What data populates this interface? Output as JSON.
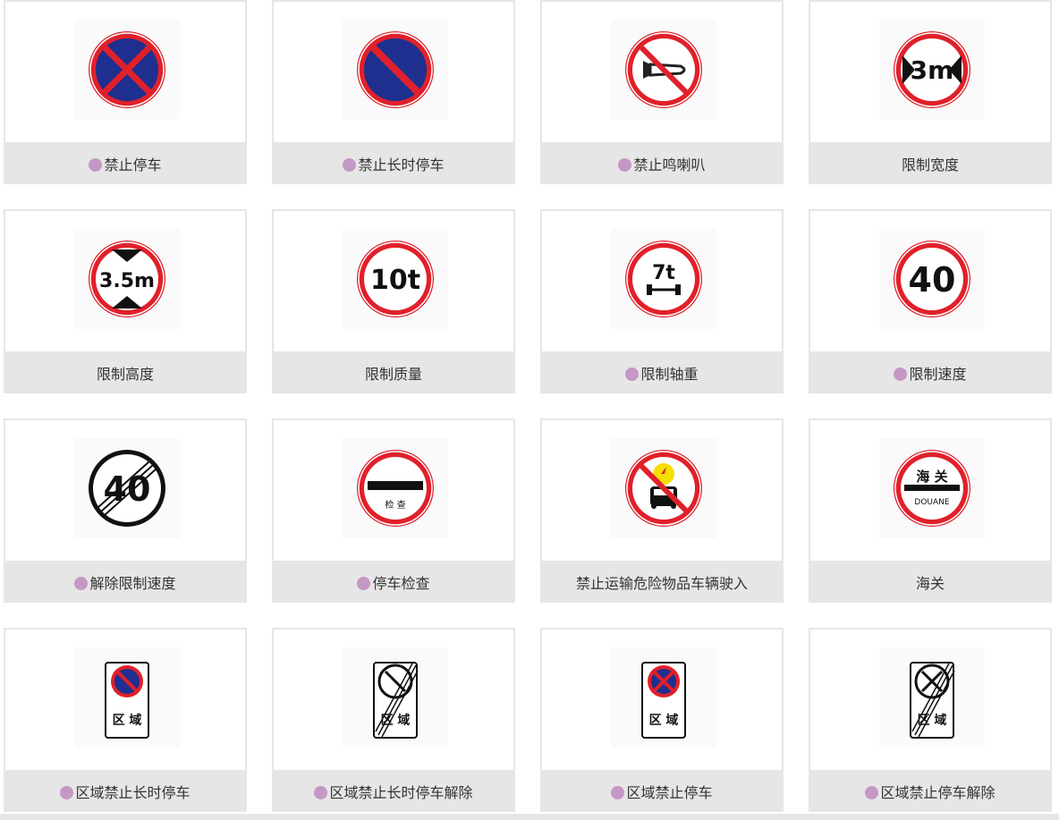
{
  "colors": {
    "dot": "#c597c5",
    "caption_bg": "#e6e6e6",
    "sign_red": "#e0202a",
    "sign_blue": "#1e2f8f"
  },
  "signs": [
    {
      "id": "no-parking",
      "label": "禁止停车",
      "dot": true,
      "icon": "no-parking-sign-icon"
    },
    {
      "id": "no-long-parking",
      "label": "禁止长时停车",
      "dot": true,
      "icon": "no-long-parking-sign-icon"
    },
    {
      "id": "no-horn",
      "label": "禁止鸣喇叭",
      "dot": true,
      "icon": "no-horn-sign-icon"
    },
    {
      "id": "width-limit",
      "label": "限制宽度",
      "dot": false,
      "icon": "width-limit-sign-icon",
      "sign_text": "3m"
    },
    {
      "id": "height-limit",
      "label": "限制高度",
      "dot": false,
      "icon": "height-limit-sign-icon",
      "sign_text": "3.5m"
    },
    {
      "id": "mass-limit",
      "label": "限制质量",
      "dot": false,
      "icon": "mass-limit-sign-icon",
      "sign_text": "10t"
    },
    {
      "id": "axle-limit",
      "label": "限制轴重",
      "dot": true,
      "icon": "axle-load-limit-sign-icon",
      "sign_text": "7t"
    },
    {
      "id": "speed-limit",
      "label": "限制速度",
      "dot": true,
      "icon": "speed-limit-sign-icon",
      "sign_text": "40"
    },
    {
      "id": "speed-limit-end",
      "label": "解除限制速度",
      "dot": true,
      "icon": "end-speed-limit-sign-icon",
      "sign_text": "40"
    },
    {
      "id": "stop-check",
      "label": "停车检查",
      "dot": true,
      "icon": "stop-for-inspection-sign-icon",
      "sign_text": "检 查"
    },
    {
      "id": "no-hazmat",
      "label": "禁止运输危险物品车辆驶入",
      "dot": false,
      "icon": "no-hazardous-vehicles-sign-icon"
    },
    {
      "id": "customs",
      "label": "海关",
      "dot": false,
      "icon": "customs-sign-icon",
      "sign_text": "海 关",
      "sign_subtext": "DOUANE"
    },
    {
      "id": "zone-no-long-parking",
      "label": "区域禁止长时停车",
      "dot": true,
      "icon": "zone-no-long-parking-sign-icon",
      "sign_text": "区 域"
    },
    {
      "id": "zone-no-long-parking-end",
      "label": "区域禁止长时停车解除",
      "dot": true,
      "icon": "end-zone-no-long-parking-sign-icon",
      "sign_text": "区 域"
    },
    {
      "id": "zone-no-parking",
      "label": "区域禁止停车",
      "dot": true,
      "icon": "zone-no-parking-sign-icon",
      "sign_text": "区 域"
    },
    {
      "id": "zone-no-parking-end",
      "label": "区域禁止停车解除",
      "dot": true,
      "icon": "end-zone-no-parking-sign-icon",
      "sign_text": "区 域"
    }
  ]
}
